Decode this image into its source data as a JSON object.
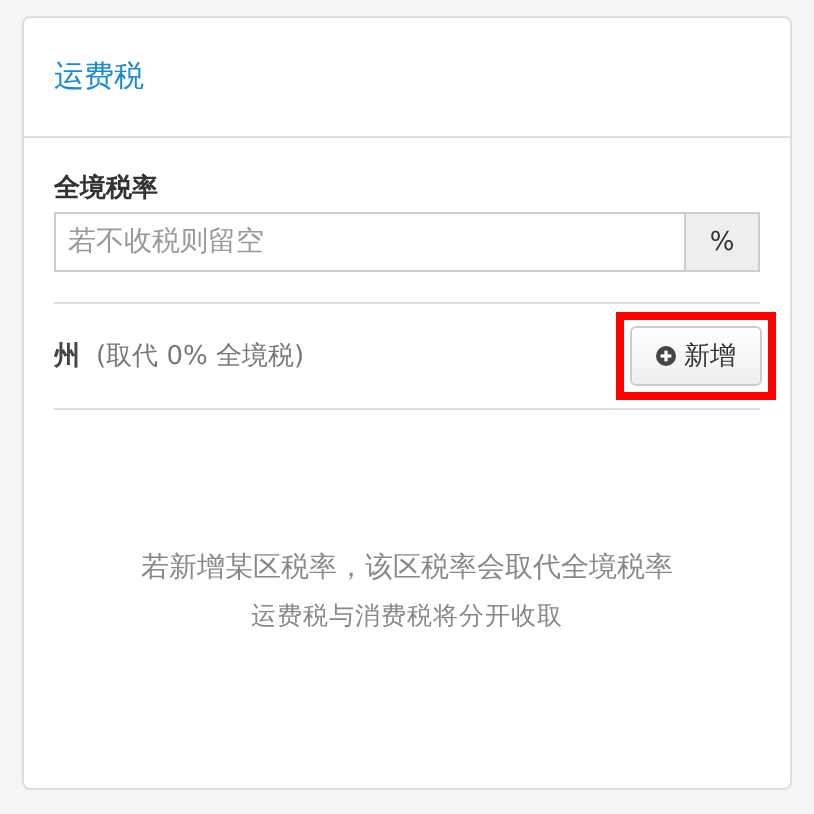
{
  "card": {
    "title": "运费税"
  },
  "country_rate": {
    "label": "全境税率",
    "placeholder": "若不收税则留空",
    "suffix": "%"
  },
  "region_row": {
    "label": "州",
    "note": "(取代 0% 全境税)",
    "button": "新增",
    "highlighted": true
  },
  "empty_state": {
    "message": "若新增某区税率，该区税率会取代全境税率",
    "note": "运费税与消费税将分开收取"
  }
}
